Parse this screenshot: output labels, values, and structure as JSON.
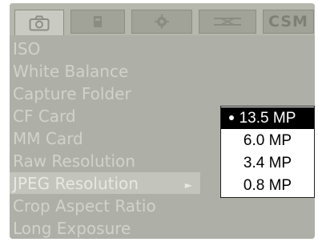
{
  "tabs": [
    {
      "icon": "camera-icon",
      "active": true
    },
    {
      "icon": "playback-icon",
      "active": false
    },
    {
      "icon": "settings-icon",
      "active": false
    },
    {
      "icon": "tools-icon",
      "active": false
    },
    {
      "label": "CSM",
      "active": false
    }
  ],
  "menu": {
    "items": [
      {
        "label": "ISO"
      },
      {
        "label": "White Balance"
      },
      {
        "label": "Capture Folder"
      },
      {
        "label": "CF Card"
      },
      {
        "label": "MM Card"
      },
      {
        "label": "Raw Resolution"
      },
      {
        "label": "JPEG Resolution",
        "selected": true
      },
      {
        "label": "Crop Aspect Ratio"
      },
      {
        "label": "Long Exposure"
      }
    ]
  },
  "submenu": {
    "options": [
      {
        "label": "13.5 MP",
        "selected": true
      },
      {
        "label": "6.0 MP"
      },
      {
        "label": "3.4 MP"
      },
      {
        "label": "0.8 MP"
      }
    ]
  },
  "colors": {
    "screen_bg": "#a9aaa1",
    "menu_text": "#d1d3ca",
    "highlight": "#c3c4bb",
    "popup_bg": "#ffffff",
    "popup_selected": "#000000"
  }
}
